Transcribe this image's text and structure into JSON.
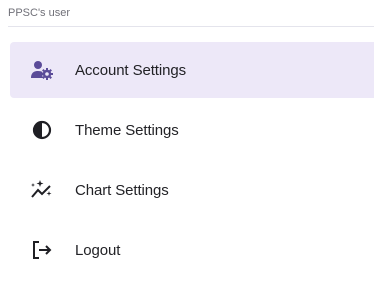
{
  "header": {
    "user_label": "PPSC's user"
  },
  "menu": {
    "items": [
      {
        "label": "Account Settings",
        "icon": "account-settings-icon",
        "active": true
      },
      {
        "label": "Theme Settings",
        "icon": "contrast-icon",
        "active": false
      },
      {
        "label": "Chart Settings",
        "icon": "sparkle-chart-icon",
        "active": false
      },
      {
        "label": "Logout",
        "icon": "logout-icon",
        "active": false
      }
    ]
  },
  "colors": {
    "active_background": "#ede8f8",
    "active_icon": "#5b4b99",
    "icon_default": "#1f1f24",
    "text": "#222226"
  }
}
